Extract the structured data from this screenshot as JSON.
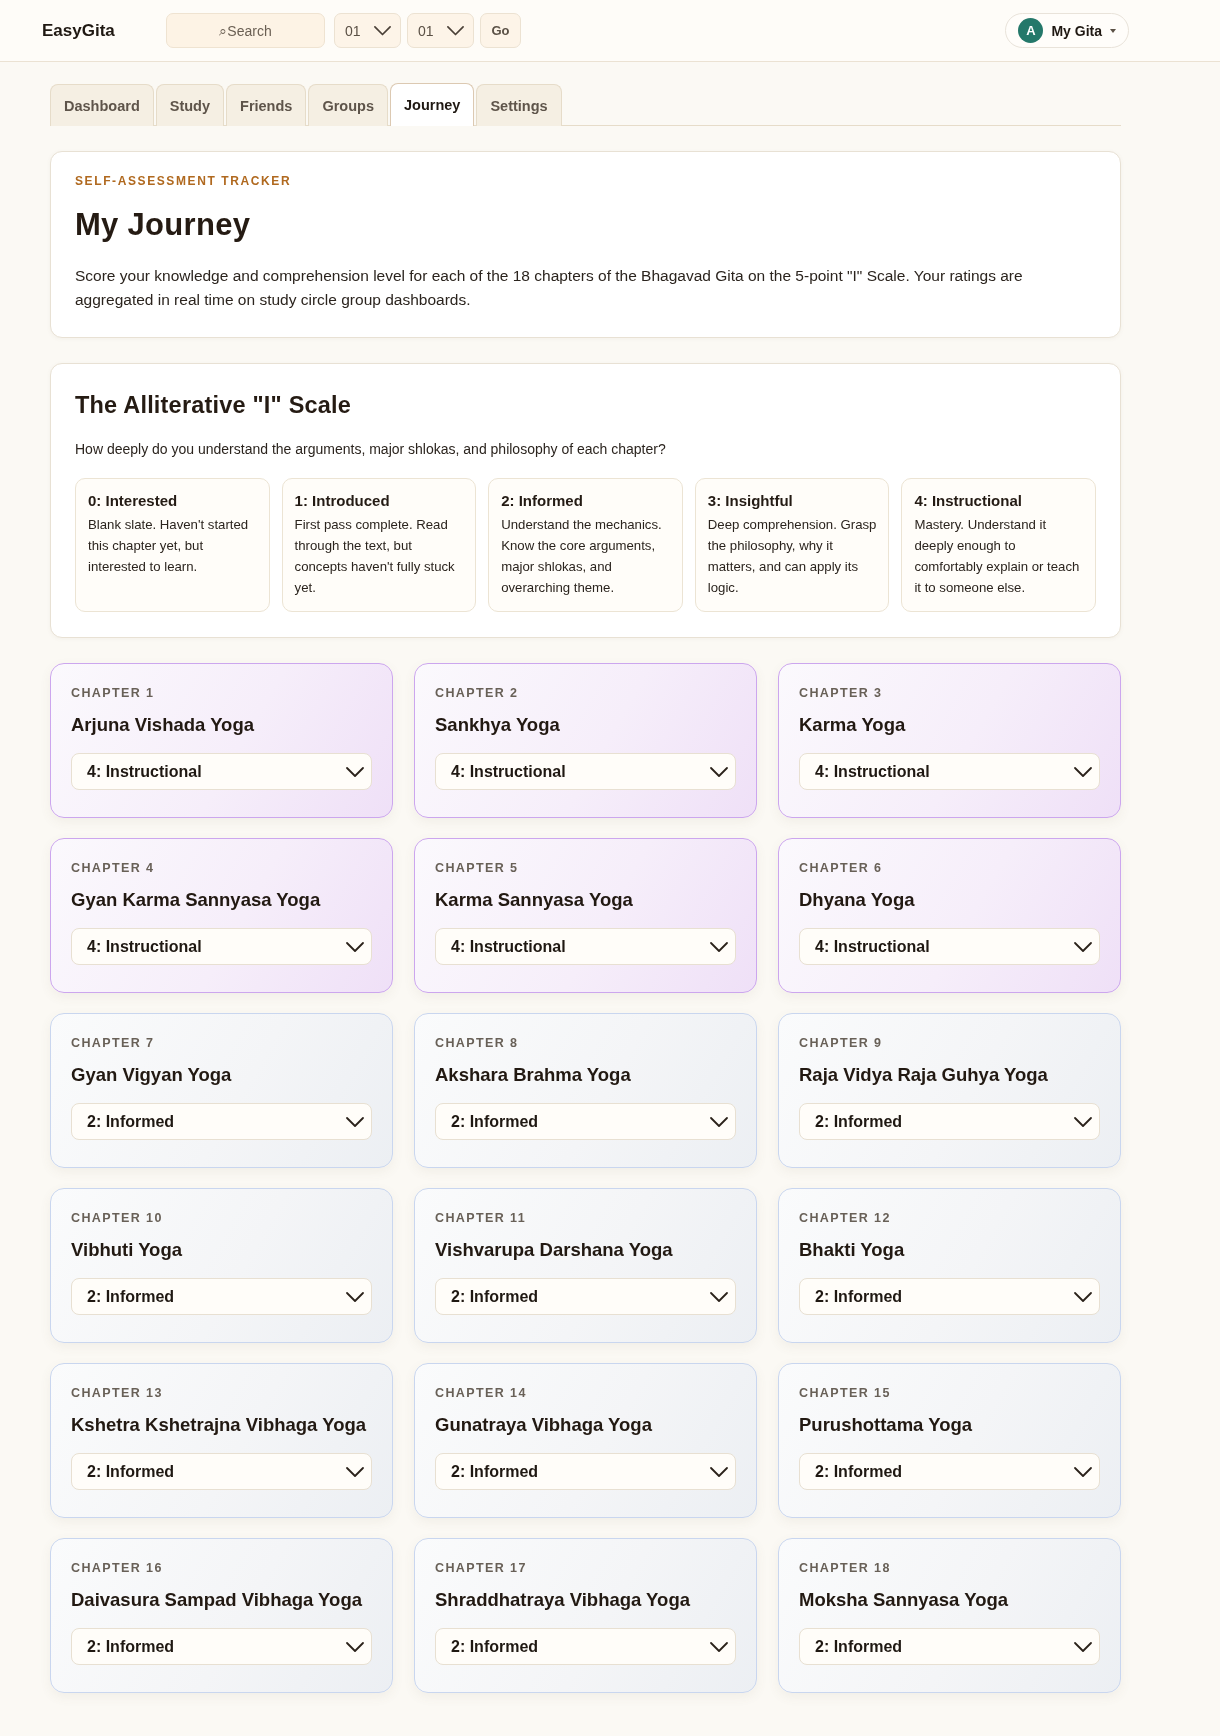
{
  "header": {
    "logo": "EasyGita",
    "search": {
      "placeholder": "⌕Search"
    },
    "selects": [
      {
        "value": "01"
      },
      {
        "value": "01"
      }
    ],
    "go_button": "Go",
    "account": {
      "avatar": "A",
      "label": "My Gita"
    }
  },
  "tabs": [
    {
      "label": "Dashboard",
      "selected": false
    },
    {
      "label": "Study",
      "selected": false
    },
    {
      "label": "Friends",
      "selected": false
    },
    {
      "label": "Groups",
      "selected": false
    },
    {
      "label": "Journey",
      "selected": true
    },
    {
      "label": "Settings",
      "selected": false
    }
  ],
  "intro": {
    "eyebrow": "SELF-ASSESSMENT TRACKER",
    "title": "My Journey",
    "text": "Score your knowledge and comprehension level for each of the 18 chapters of the Bhagavad Gita on the 5-point \"I\" Scale. Your ratings are aggregated in real time on study circle group dashboards."
  },
  "scale": {
    "title": "The Alliterative \"I\" Scale",
    "question": "How deeply do you understand the arguments, major shlokas, and philosophy of each chapter?",
    "levels": [
      {
        "title": "0: Interested",
        "text": "Blank slate. Haven't started this chapter yet, but interested to learn."
      },
      {
        "title": "1: Introduced",
        "text": "First pass complete. Read through the text, but concepts haven't fully stuck yet."
      },
      {
        "title": "2: Informed",
        "text": "Understand the mechanics. Know the core arguments, major shlokas, and overarching theme."
      },
      {
        "title": "3: Insightful",
        "text": "Deep comprehension. Grasp the philosophy, why it matters, and can apply its logic."
      },
      {
        "title": "4: Instructional",
        "text": "Mastery. Understand it deeply enough to comfortably explain or teach it to someone else."
      }
    ]
  },
  "chapters": [
    {
      "label": "CHAPTER 1",
      "name": "Arjuna Vishada Yoga",
      "rating": "4: Instructional",
      "kind": "instructional"
    },
    {
      "label": "CHAPTER 2",
      "name": "Sankhya Yoga",
      "rating": "4: Instructional",
      "kind": "instructional"
    },
    {
      "label": "CHAPTER 3",
      "name": "Karma Yoga",
      "rating": "4: Instructional",
      "kind": "instructional"
    },
    {
      "label": "CHAPTER 4",
      "name": "Gyan Karma Sannyasa Yoga",
      "rating": "4: Instructional",
      "kind": "instructional"
    },
    {
      "label": "CHAPTER 5",
      "name": "Karma Sannyasa Yoga",
      "rating": "4: Instructional",
      "kind": "instructional"
    },
    {
      "label": "CHAPTER 6",
      "name": "Dhyana Yoga",
      "rating": "4: Instructional",
      "kind": "instructional"
    },
    {
      "label": "CHAPTER 7",
      "name": "Gyan Vigyan Yoga",
      "rating": "2: Informed",
      "kind": "informed"
    },
    {
      "label": "CHAPTER 8",
      "name": "Akshara Brahma Yoga",
      "rating": "2: Informed",
      "kind": "informed"
    },
    {
      "label": "CHAPTER 9",
      "name": "Raja Vidya Raja Guhya Yoga",
      "rating": "2: Informed",
      "kind": "informed"
    },
    {
      "label": "CHAPTER 10",
      "name": "Vibhuti Yoga",
      "rating": "2: Informed",
      "kind": "informed"
    },
    {
      "label": "CHAPTER 11",
      "name": "Vishvarupa Darshana Yoga",
      "rating": "2: Informed",
      "kind": "informed"
    },
    {
      "label": "CHAPTER 12",
      "name": "Bhakti Yoga",
      "rating": "2: Informed",
      "kind": "informed"
    },
    {
      "label": "CHAPTER 13",
      "name": "Kshetra Kshetrajna Vibhaga Yoga",
      "rating": "2: Informed",
      "kind": "informed"
    },
    {
      "label": "CHAPTER 14",
      "name": "Gunatraya Vibhaga Yoga",
      "rating": "2: Informed",
      "kind": "informed"
    },
    {
      "label": "CHAPTER 15",
      "name": "Purushottama Yoga",
      "rating": "2: Informed",
      "kind": "informed"
    },
    {
      "label": "CHAPTER 16",
      "name": "Daivasura Sampad Vibhaga Yoga",
      "rating": "2: Informed",
      "kind": "informed"
    },
    {
      "label": "CHAPTER 17",
      "name": "Shraddhatraya Vibhaga Yoga",
      "rating": "2: Informed",
      "kind": "informed"
    },
    {
      "label": "CHAPTER 18",
      "name": "Moksha Sannyasa Yoga",
      "rating": "2: Informed",
      "kind": "informed"
    }
  ]
}
